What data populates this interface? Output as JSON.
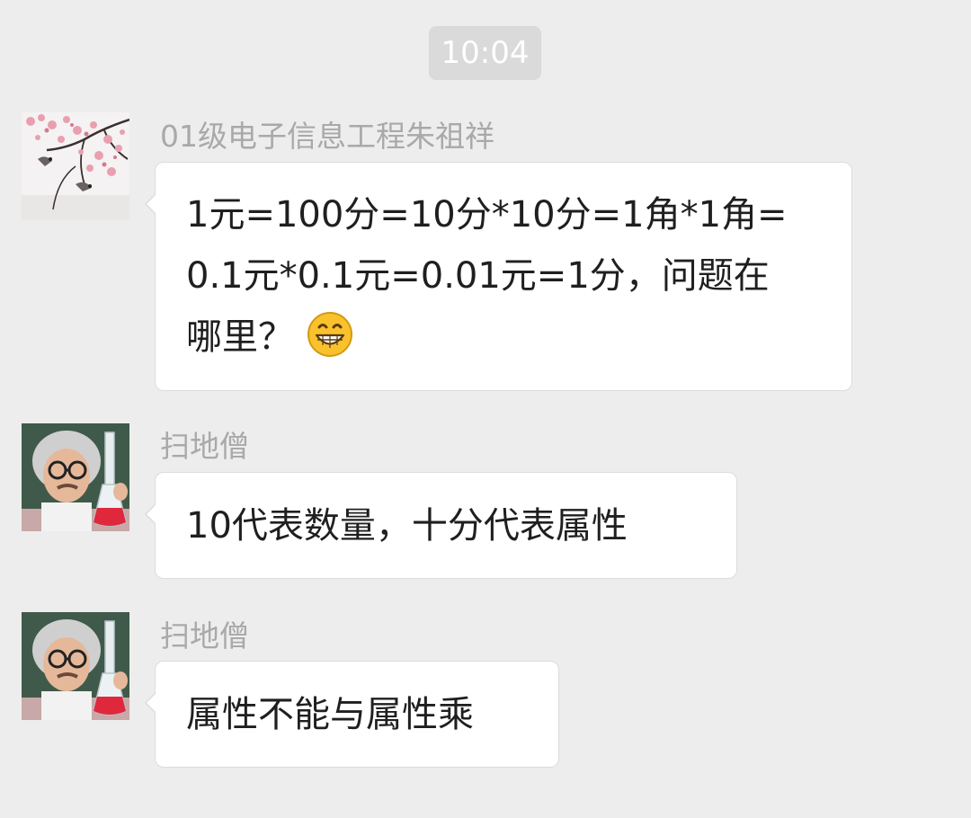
{
  "timestamp": "10:04",
  "messages": [
    {
      "sender": "01级电子信息工程朱祖祥",
      "avatar": "plum-blossom-birds-avatar",
      "text": "1元=100分=10分*10分=1角*1角=\n0.1元*0.1元=0.01元=1分，问题在\n哪里？",
      "emoji": "grinning-face-emoji"
    },
    {
      "sender": "扫地僧",
      "avatar": "scientist-child-avatar",
      "text": "10代表数量，十分代表属性"
    },
    {
      "sender": "扫地僧",
      "avatar": "scientist-child-avatar",
      "text": "属性不能与属性乘"
    }
  ]
}
